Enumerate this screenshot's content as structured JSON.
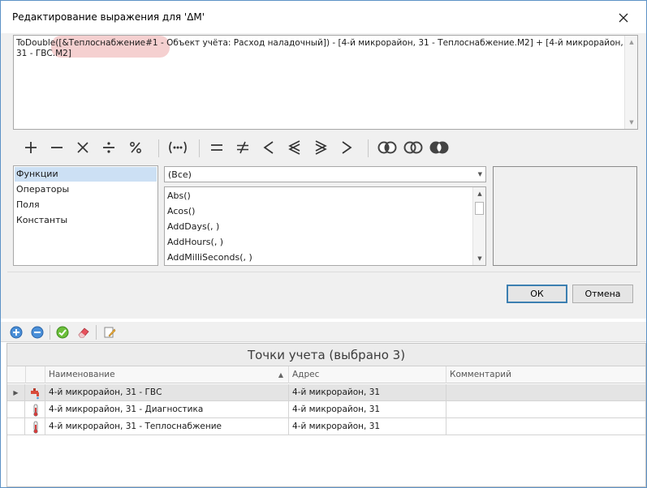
{
  "dialog": {
    "title": "Редактирование выражения для 'ΔM'",
    "expression": "ToDouble([&Теплоснабжение#1 - Объект учёта: Расход наладочный]) - [4-й микрорайон, 31 - Теплоснабжение.M2] + [4-й микрорайон, 31 - ГВС.M2]",
    "operators": [
      {
        "name": "plus-operator",
        "glyph": "+"
      },
      {
        "name": "minus-operator",
        "glyph": "−"
      },
      {
        "name": "multiply-operator",
        "glyph": "×"
      },
      {
        "name": "divide-operator",
        "glyph": "÷"
      },
      {
        "name": "percent-operator",
        "glyph": "%"
      },
      {
        "name": "brackets-operator",
        "glyph": "(•••)"
      },
      {
        "name": "equal-operator",
        "glyph": "="
      },
      {
        "name": "not-equal-operator",
        "glyph": "≠"
      },
      {
        "name": "less-operator",
        "glyph": "<"
      },
      {
        "name": "less-equal-operator",
        "glyph": "≤"
      },
      {
        "name": "greater-equal-operator",
        "glyph": "≥"
      },
      {
        "name": "greater-operator",
        "glyph": ">"
      },
      {
        "name": "and-operator",
        "glyph": "and"
      },
      {
        "name": "or-operator",
        "glyph": "or"
      },
      {
        "name": "not-operator",
        "glyph": "not"
      }
    ],
    "categories": [
      "Функции",
      "Операторы",
      "Поля",
      "Константы"
    ],
    "selected_category": "Функции",
    "function_filter": "(Все)",
    "functions": [
      "Abs()",
      "Acos()",
      "AddDays(, )",
      "AddHours(, )",
      "AddMilliSeconds(, )"
    ],
    "ok_label": "ОК",
    "cancel_label": "Отмена"
  },
  "grid": {
    "title": "Точки учета (выбрано 3)",
    "columns": [
      "Наименование",
      "Адрес",
      "Комментарий"
    ],
    "rows": [
      {
        "icon": "faucet-icon",
        "name": "4-й микрорайон, 31 - ГВС",
        "address": "4-й микрорайон, 31",
        "comment": ""
      },
      {
        "icon": "thermometer-icon",
        "name": "4-й микрорайон, 31 - Диагностика",
        "address": "4-й микрорайон, 31",
        "comment": ""
      },
      {
        "icon": "thermometer-icon",
        "name": "4-й микрорайон, 31 - Теплоснабжение",
        "address": "4-й микрорайон, 31",
        "comment": ""
      }
    ]
  },
  "toolbar": {
    "buttons": [
      "add-icon",
      "remove-icon",
      "apply-icon",
      "eraser-icon",
      "edit-icon"
    ]
  },
  "colors": {
    "accent": "#3c7fb1",
    "selection": "#cce0f4",
    "highlight": "#e89696"
  }
}
